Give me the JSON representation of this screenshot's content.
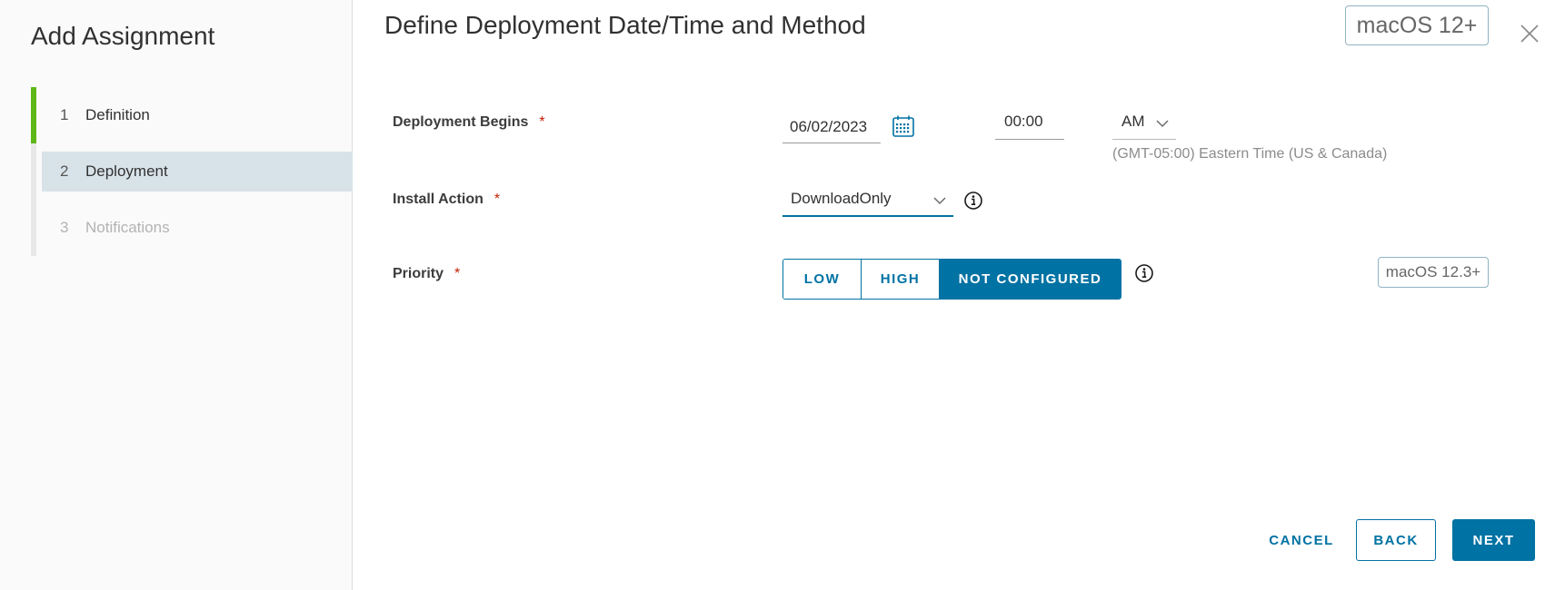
{
  "sidebar": {
    "title": "Add Assignment",
    "steps": [
      {
        "num": "1",
        "label": "Definition",
        "state": "done"
      },
      {
        "num": "2",
        "label": "Deployment",
        "state": "current"
      },
      {
        "num": "3",
        "label": "Notifications",
        "state": "pending"
      }
    ]
  },
  "main": {
    "title": "Define Deployment Date/Time and Method",
    "os_badge": "macOS 12+",
    "deployment_begins": {
      "label": "Deployment Begins",
      "required": "*",
      "date": "06/02/2023",
      "time": "00:00",
      "ampm": "AM",
      "timezone": "(GMT-05:00) Eastern Time (US & Canada)"
    },
    "install_action": {
      "label": "Install Action",
      "required": "*",
      "value": "DownloadOnly"
    },
    "priority": {
      "label": "Priority",
      "required": "*",
      "options": [
        "LOW",
        "HIGH",
        "NOT CONFIGURED"
      ],
      "selected": "NOT CONFIGURED",
      "os_badge": "macOS 12.3+"
    }
  },
  "footer": {
    "cancel": "CANCEL",
    "back": "BACK",
    "next": "NEXT"
  },
  "colors": {
    "accent": "#0072a3",
    "step_done": "#5eb715",
    "required": "#c21d00"
  }
}
